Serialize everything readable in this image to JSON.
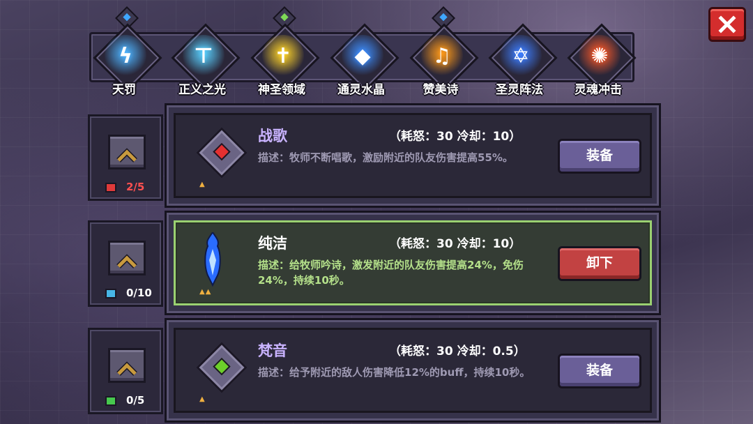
{
  "close_icon": "close-icon",
  "skills": [
    {
      "name": "天罚",
      "icon": "swirl-icon",
      "color": "#4fb4ff",
      "glyph": "ϟ",
      "gem": "#3fa7ff"
    },
    {
      "name": "正义之光",
      "icon": "hammer-icon",
      "color": "#5ad0ff",
      "glyph": "⊤",
      "gem": null
    },
    {
      "name": "神圣领域",
      "icon": "cross-icon",
      "color": "#ffd42a",
      "glyph": "✝",
      "gem": "#7ed957"
    },
    {
      "name": "通灵水晶",
      "icon": "crystal-icon",
      "color": "#3f8fff",
      "glyph": "◆",
      "gem": null
    },
    {
      "name": "赞美诗",
      "icon": "music-note-icon",
      "color": "#ff9a1a",
      "glyph": "♫",
      "gem": "#3fa7ff"
    },
    {
      "name": "圣灵阵法",
      "icon": "hexagram-icon",
      "color": "#3f7fff",
      "glyph": "✡",
      "gem": null
    },
    {
      "name": "灵魂冲击",
      "icon": "fire-icon",
      "color": "#ff5b2a",
      "glyph": "✺",
      "gem": null
    }
  ],
  "rows": [
    {
      "level": "2/5",
      "level_color": "#ff5050",
      "book_color": "#e03a3a",
      "title": "战歌",
      "stats": "（耗怒：30  冷却：10）",
      "desc": "描述：牧师不断唱歌，激励附近的队友伤害提高55%。",
      "button": "装备",
      "gem_color": "#e53030",
      "stars": "▲",
      "selected": false
    },
    {
      "level": "0/10",
      "level_color": "#ffffff",
      "book_color": "#47b6e6",
      "title": "纯洁",
      "stats": "（耗怒：30  冷却：10）",
      "desc": "描述：给牧师吟诗，激发附近的队友伤害提高24%，免伤24%，持续10秒。",
      "button": "卸下",
      "gem_color": "#2a6cff",
      "stars": "▲▲",
      "selected": true
    },
    {
      "level": "0/5",
      "level_color": "#ffffff",
      "book_color": "#47c94e",
      "title": "梵音",
      "stats": "（耗怒：30  冷却：0.5）",
      "desc": "描述：给予附近的敌人伤害降低12%的buff，持续10秒。",
      "button": "装备",
      "gem_color": "#6ccf2a",
      "stars": "▲",
      "selected": false
    }
  ]
}
